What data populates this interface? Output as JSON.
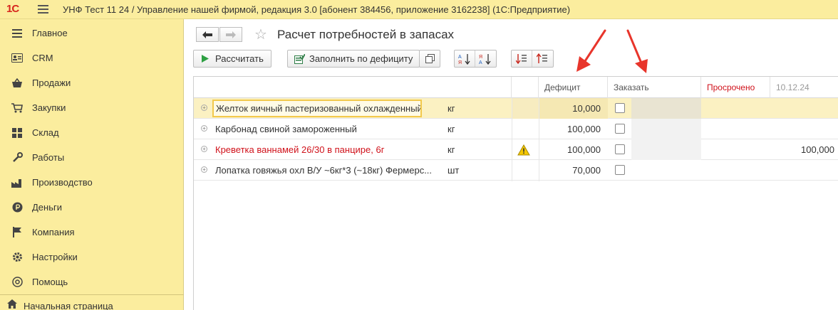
{
  "app": {
    "logo": "1С",
    "title": "УНФ Тест 11 24 / Управление нашей фирмой, редакция 3.0 [абонент 384456, приложение 3162238]  (1С:Предприятие)"
  },
  "sidebar": {
    "items": [
      {
        "label": "Главное",
        "icon": "menu-lines-icon"
      },
      {
        "label": "CRM",
        "icon": "contact-card-icon"
      },
      {
        "label": "Продажи",
        "icon": "basket-icon"
      },
      {
        "label": "Закупки",
        "icon": "cart-icon"
      },
      {
        "label": "Склад",
        "icon": "warehouse-grid-icon"
      },
      {
        "label": "Работы",
        "icon": "tools-icon"
      },
      {
        "label": "Производство",
        "icon": "factory-icon"
      },
      {
        "label": "Деньги",
        "icon": "ruble-coin-icon"
      },
      {
        "label": "Компания",
        "icon": "flag-icon"
      },
      {
        "label": "Настройки",
        "icon": "gear-icon"
      },
      {
        "label": "Помощь",
        "icon": "help-icon"
      }
    ],
    "home": "Начальная страница"
  },
  "page": {
    "title": "Расчет потребностей в запасах"
  },
  "toolbar": {
    "calculate": "Рассчитать",
    "fill_deficit": "Заполнить по дефициту"
  },
  "table": {
    "columns": {
      "deficit": "Дефицит",
      "order": "Заказать",
      "overdue": "Просрочено",
      "date": "10.12.24"
    },
    "rows": [
      {
        "name": "Желток яичный пастеризованный охлажденный",
        "unit": "кг",
        "warning": false,
        "deficit": "10,000",
        "overdue": "",
        "date_val": ""
      },
      {
        "name": "Карбонад свиной замороженный",
        "unit": "кг",
        "warning": false,
        "deficit": "100,000",
        "overdue": "",
        "date_val": ""
      },
      {
        "name": "Креветка ваннамей 26/30 в панцире, 6г",
        "unit": "кг",
        "warning": true,
        "deficit": "100,000",
        "overdue": "",
        "date_val": "100,000"
      },
      {
        "name": "Лопатка говяжья охл В/У ~6кг*3 (~18кг) Фермерс...",
        "unit": "шт",
        "warning": false,
        "deficit": "70,000",
        "overdue": "",
        "date_val": ""
      }
    ]
  },
  "colors": {
    "sidebar_bg": "#fbed9e",
    "overdue_red": "#d0121b",
    "warning_row_red": "#d0121b",
    "selected_row": "#fbf1c2",
    "annotation_arrow": "#e8352b"
  }
}
